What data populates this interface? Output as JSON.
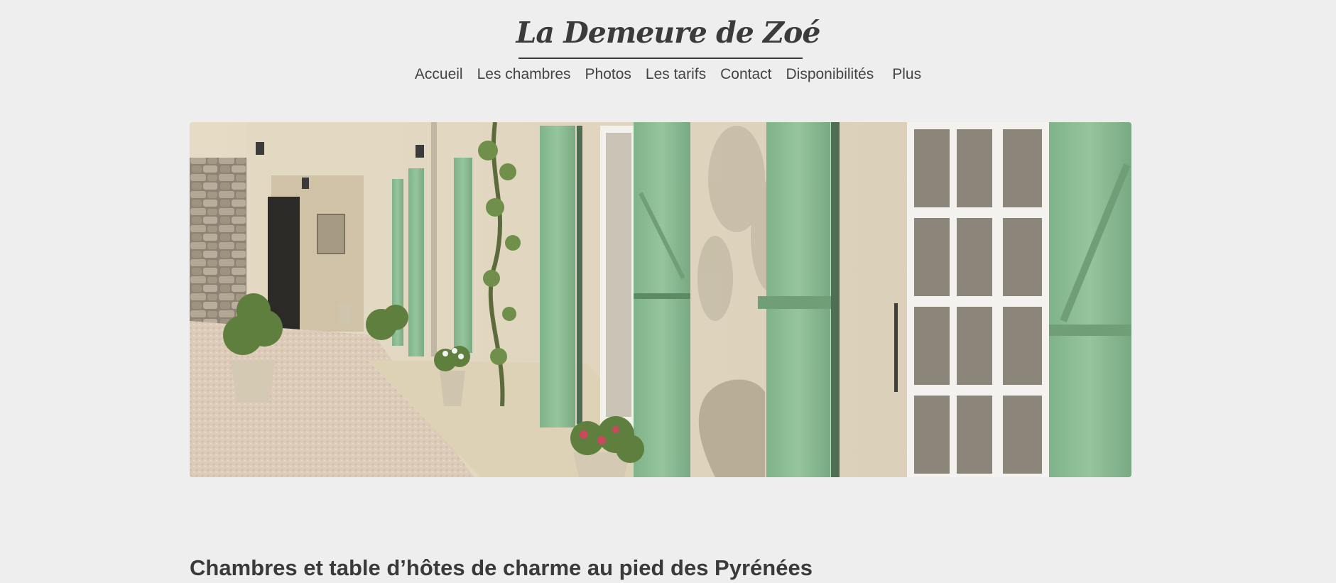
{
  "site": {
    "title": "La Demeure de Zoé"
  },
  "nav": {
    "items": [
      {
        "label": "Accueil"
      },
      {
        "label": "Les chambres"
      },
      {
        "label": "Photos"
      },
      {
        "label": "Les tarifs"
      },
      {
        "label": "Contact"
      },
      {
        "label": "Disponibilités"
      }
    ],
    "more_label": "Plus"
  },
  "hero": {
    "image_subject": "house-facade-with-green-shutters",
    "colors": {
      "shutter": "#8fbf95",
      "wall": "#ddd3bd",
      "gravel": "#d8c8b6"
    }
  },
  "main": {
    "heading": "Chambres et table d’hôtes de charme au pied des Pyrénées"
  },
  "colors": {
    "background": "#eeeeee",
    "text": "#3a3a3a"
  }
}
